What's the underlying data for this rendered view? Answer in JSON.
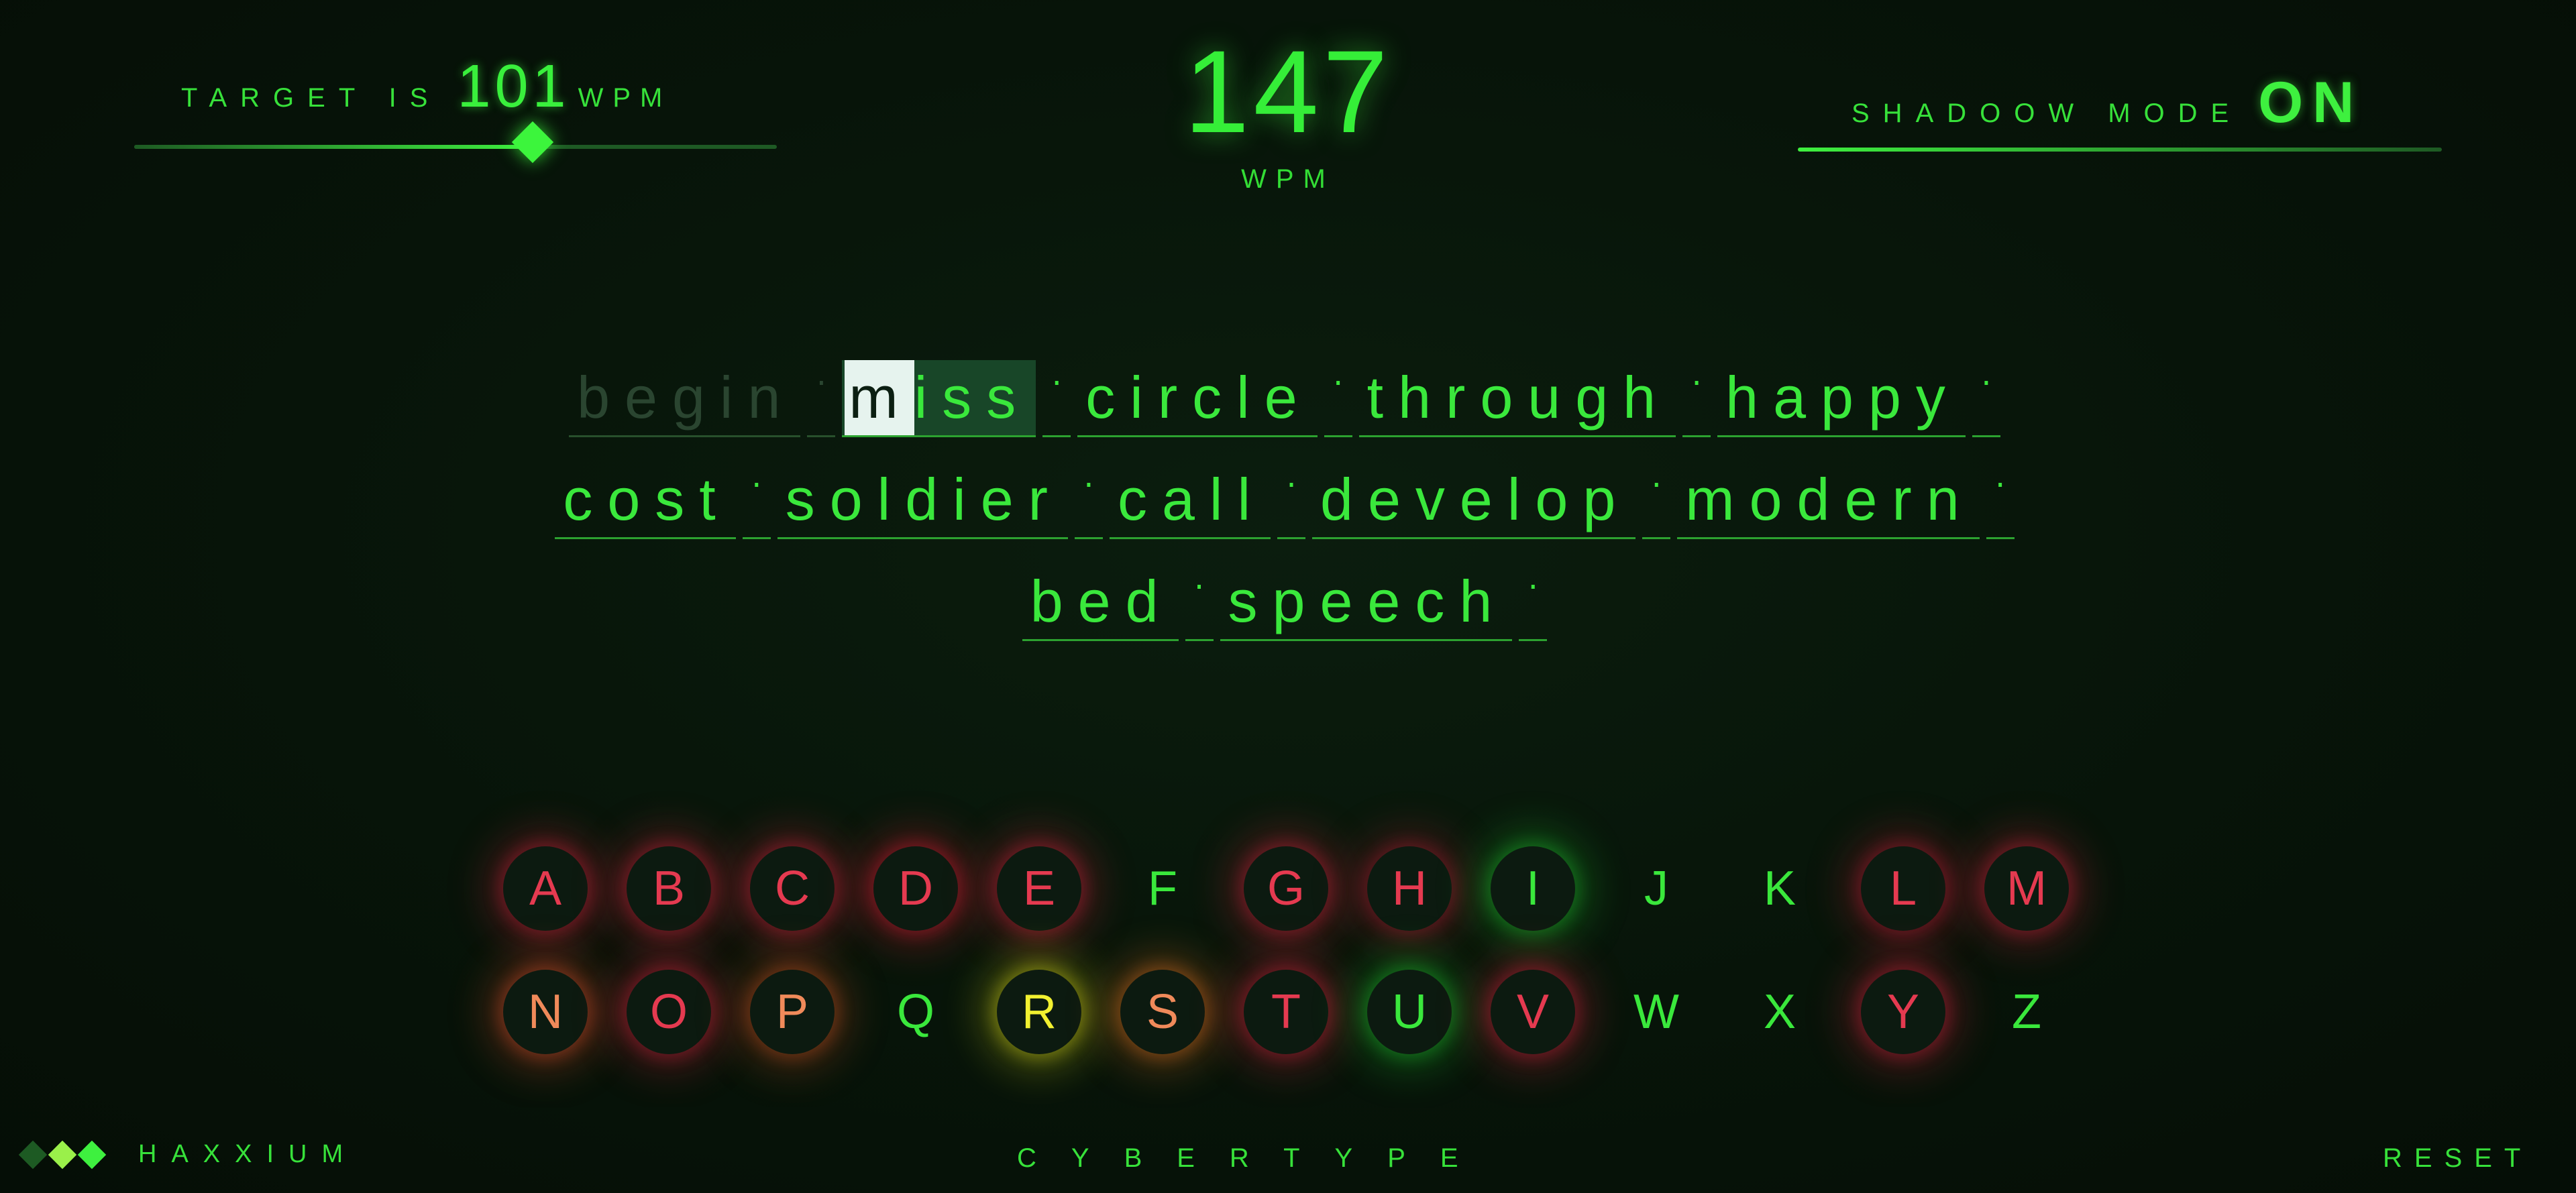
{
  "target": {
    "label": "TARGET IS",
    "value": "101",
    "unit": "WPM",
    "slider_fraction": 0.62
  },
  "speed": {
    "value": "147",
    "unit": "WPM"
  },
  "shadow_mode": {
    "label": "SHADOOW MODE",
    "value": "ON"
  },
  "words": {
    "separator": "·",
    "lines": [
      [
        {
          "text": "begin",
          "state": "done"
        },
        {
          "text": "miss",
          "state": "current",
          "current_char": "m",
          "rest": "iss"
        },
        {
          "text": "circle",
          "state": "pending"
        },
        {
          "text": "through",
          "state": "pending"
        },
        {
          "text": "happy",
          "state": "pending"
        }
      ],
      [
        {
          "text": "cost",
          "state": "pending"
        },
        {
          "text": "soldier",
          "state": "pending"
        },
        {
          "text": "call",
          "state": "pending"
        },
        {
          "text": "develop",
          "state": "pending"
        },
        {
          "text": "modern",
          "state": "pending"
        }
      ],
      [
        {
          "text": "bed",
          "state": "pending"
        },
        {
          "text": "speech",
          "state": "pending"
        }
      ]
    ]
  },
  "keyboard": {
    "rows": [
      [
        {
          "letter": "A",
          "color": "#e53a50",
          "glow": "#c0203a",
          "bg": "dark"
        },
        {
          "letter": "B",
          "color": "#e53a50",
          "glow": "#c0203a",
          "bg": "dark"
        },
        {
          "letter": "C",
          "color": "#e53a50",
          "glow": "#c0203a",
          "bg": "dark"
        },
        {
          "letter": "D",
          "color": "#e53a50",
          "glow": "#d01a32",
          "bg": "dark"
        },
        {
          "letter": "E",
          "color": "#e53a50",
          "glow": "#c0203a",
          "bg": "dark"
        },
        {
          "letter": "F",
          "color": "#3ae83c",
          "glow": "",
          "bg": "plain"
        },
        {
          "letter": "G",
          "color": "#e53a50",
          "glow": "#c0203a",
          "bg": "dark"
        },
        {
          "letter": "H",
          "color": "#e53a50",
          "glow": "#a01c30",
          "bg": "dark"
        },
        {
          "letter": "I",
          "color": "#3ae83c",
          "glow": "#1fb02a",
          "bg": "dark"
        },
        {
          "letter": "J",
          "color": "#3ae83c",
          "glow": "",
          "bg": "plain"
        },
        {
          "letter": "K",
          "color": "#3ae83c",
          "glow": "",
          "bg": "plain"
        },
        {
          "letter": "L",
          "color": "#e53a50",
          "glow": "#b01c34",
          "bg": "dark"
        },
        {
          "letter": "M",
          "color": "#e53a50",
          "glow": "#c0203a",
          "bg": "dark"
        }
      ],
      [
        {
          "letter": "N",
          "color": "#f08a5a",
          "glow": "#d04a2a",
          "bg": "dark"
        },
        {
          "letter": "O",
          "color": "#e53a50",
          "glow": "#c0203a",
          "bg": "dark"
        },
        {
          "letter": "P",
          "color": "#f08a5a",
          "glow": "#b84a20",
          "bg": "dark"
        },
        {
          "letter": "Q",
          "color": "#3ae83c",
          "glow": "",
          "bg": "plain"
        },
        {
          "letter": "R",
          "color": "#f2f030",
          "glow": "#c8c818",
          "bg": "dark"
        },
        {
          "letter": "S",
          "color": "#f08a5a",
          "glow": "#d06a20",
          "bg": "dark"
        },
        {
          "letter": "T",
          "color": "#e53a50",
          "glow": "#c0203a",
          "bg": "dark"
        },
        {
          "letter": "U",
          "color": "#3ae83c",
          "glow": "#1fb02a",
          "bg": "dark"
        },
        {
          "letter": "V",
          "color": "#e53a50",
          "glow": "#c0203a",
          "bg": "dark"
        },
        {
          "letter": "W",
          "color": "#3ae83c",
          "glow": "",
          "bg": "plain"
        },
        {
          "letter": "X",
          "color": "#3ae83c",
          "glow": "",
          "bg": "plain"
        },
        {
          "letter": "Y",
          "color": "#e53a50",
          "glow": "#c0203a",
          "bg": "dark"
        },
        {
          "letter": "Z",
          "color": "#3ae83c",
          "glow": "",
          "bg": "plain"
        }
      ]
    ]
  },
  "footer": {
    "brand": "HAXXIUM",
    "logo_colors": [
      "#1d5a23",
      "#9af04a",
      "#3ef03f"
    ],
    "title": "CYBERTYPE",
    "reset": "RESET"
  }
}
